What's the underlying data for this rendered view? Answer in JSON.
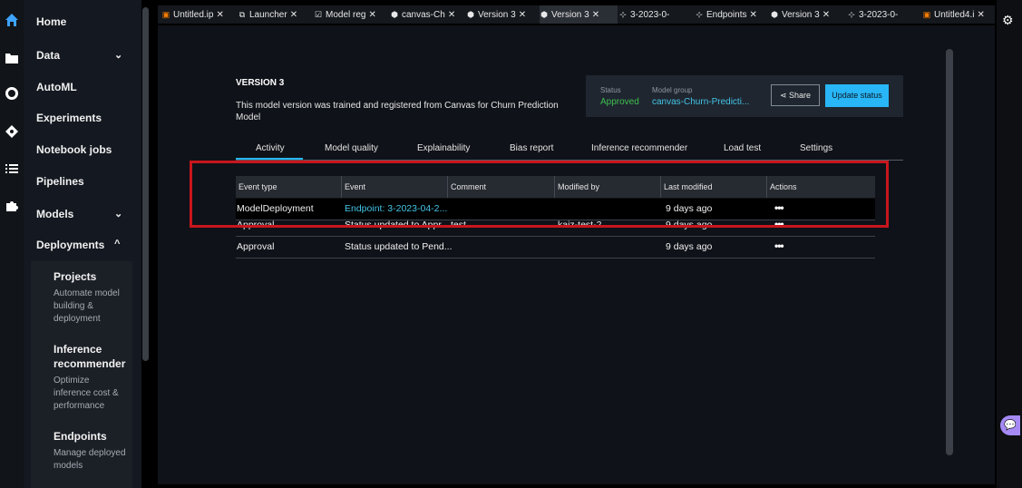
{
  "sidebar": {
    "items": [
      {
        "label": "Home",
        "icon": "home-icon"
      },
      {
        "label": "Data",
        "icon": "folder-icon",
        "chevron": "⌄"
      },
      {
        "label": "AutoML",
        "icon": "circle-icon"
      },
      {
        "label": "Experiments",
        "icon": "diamond-icon"
      },
      {
        "label": "Notebook jobs",
        "icon": "list-icon"
      },
      {
        "label": "Pipelines",
        "icon": "puzzle-icon"
      },
      {
        "label": "Models",
        "chevron": "⌄"
      },
      {
        "label": "Deployments",
        "chevron": "^"
      }
    ],
    "deployments_sub": [
      {
        "title": "Projects",
        "desc": [
          "Automate model",
          "building &",
          "deployment"
        ]
      },
      {
        "title": "Inference recommender",
        "desc": [
          "Optimize",
          "inference cost &",
          "performance"
        ]
      },
      {
        "title": "Endpoints",
        "desc": [
          "Manage deployed",
          "models"
        ]
      }
    ]
  },
  "tabs": [
    {
      "label": "Untitled.ip",
      "icon": "notebook-icon"
    },
    {
      "label": "Launcher",
      "icon": "launcher-icon"
    },
    {
      "label": "Model reg",
      "icon": "model-registry-icon"
    },
    {
      "label": "canvas-Ch",
      "icon": "package-icon"
    },
    {
      "label": "Version 3",
      "icon": "package-icon"
    },
    {
      "label": "Version 3",
      "icon": "package-icon"
    },
    {
      "label": "3-2023-0-",
      "icon": "endpoint-icon"
    },
    {
      "label": "Endpoints",
      "icon": "endpoint-icon"
    },
    {
      "label": "Version 3",
      "icon": "package-icon"
    },
    {
      "label": "3-2023-0-",
      "icon": "endpoint-icon"
    },
    {
      "label": "Untitled4.i",
      "icon": "notebook-icon"
    }
  ],
  "version": {
    "title": "VERSION 3",
    "description": "This model version was trained and registered from Canvas for Churn Prediction Model"
  },
  "status_panel": {
    "status_label": "Status",
    "status_value": "Approved",
    "group_label": "Model group",
    "group_value": "canvas-Churn-Predicti...",
    "share_label": "Share",
    "update_label": "Update status"
  },
  "subtabs": [
    "Activity",
    "Model quality",
    "Explainability",
    "Bias report",
    "Inference recommender",
    "Load test",
    "Settings"
  ],
  "table": {
    "columns": [
      "Event type",
      "Event",
      "Comment",
      "Modified by",
      "Last modified",
      "Actions"
    ],
    "rows": [
      {
        "event_type": "ModelDeployment",
        "event": "Endpoint: 3-2023-04-2...",
        "comment": "",
        "modified_by": "",
        "last_modified": "9 days ago",
        "actions": "•••"
      },
      {
        "event_type": "Approval",
        "event": "Status updated to Appr...",
        "comment": "test",
        "modified_by": "kaiz-test-2",
        "last_modified": "9 days ago",
        "actions": "•••"
      },
      {
        "event_type": "Approval",
        "event": "Status updated to Pend...",
        "comment": "",
        "modified_by": "",
        "last_modified": "9 days ago",
        "actions": "•••"
      }
    ]
  },
  "colors": {
    "accent": "#29b6f6",
    "approved": "#3fbf4f",
    "link": "#44c4e6",
    "highlight_border": "#c8161d"
  }
}
